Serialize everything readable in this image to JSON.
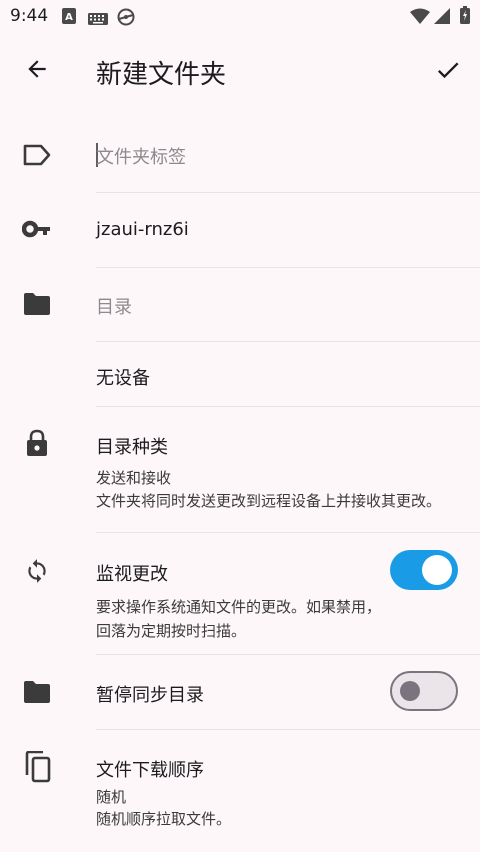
{
  "status_bar": {
    "time": "9:44",
    "icons": [
      "font-a-icon",
      "keyboard-icon",
      "sync-service-icon",
      "wifi-icon",
      "cellular-icon",
      "battery-icon"
    ]
  },
  "app_bar": {
    "title": "新建文件夹",
    "back_icon": "arrow-back-icon",
    "confirm_icon": "check-icon"
  },
  "form": {
    "label_placeholder": "文件夹标签",
    "folder_id": "jzaui-rnz6i",
    "directory_placeholder": "目录",
    "devices": "无设备",
    "folder_type": {
      "title": "目录种类",
      "value": "发送和接收",
      "description": "文件夹将同时发送更改到远程设备上并接收其更改。"
    },
    "watch_changes": {
      "title": "监视更改",
      "description_line1": "要求操作系统通知文件的更改。如果禁用，",
      "description_line2": "回落为定期按时扫描。",
      "enabled": true
    },
    "pause_sync": {
      "title": "暂停同步目录",
      "enabled": false
    },
    "pull_order": {
      "title": "文件下载顺序",
      "value": "随机",
      "description": "随机顺序拉取文件。"
    }
  },
  "colors": {
    "background": "#fdf7fa",
    "accent": "#1a9be6",
    "icon": "#3b3b3b",
    "placeholder": "#8d8a8f"
  }
}
